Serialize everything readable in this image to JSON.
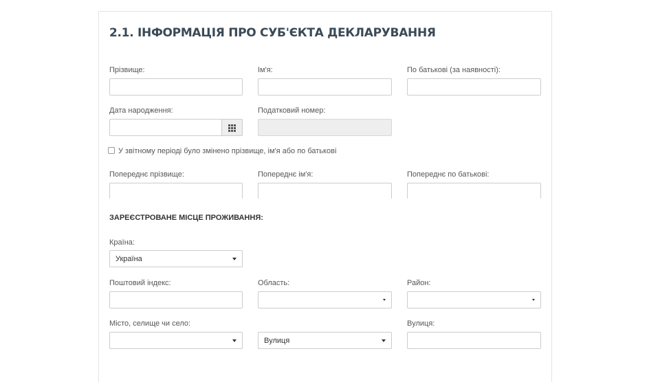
{
  "section_title": "2.1. ІНФОРМАЦІЯ ПРО СУБ'ЄКТА ДЕКЛАРУВАННЯ",
  "fields": {
    "surname_label": "Прізвище:",
    "name_label": "Ім'я:",
    "patronymic_label": "По батькові (за наявності):",
    "birth_date_label": "Дата народження:",
    "tax_number_label": "Податковий номер:",
    "name_changed_label": "У звітному періоді було змінено прізвище, ім'я або по батькові",
    "prev_surname_label": "Попереднє прізвище:",
    "prev_name_label": "Попереднє ім'я:",
    "prev_patronymic_label": "Попереднє по батькові:"
  },
  "residence": {
    "heading": "ЗАРЕЄСТРОВАНЕ МІСЦЕ ПРОЖИВАННЯ:",
    "country_label": "Країна:",
    "country_value": "Україна",
    "postal_label": "Поштовий індекс:",
    "region_label": "Область:",
    "district_label": "Район:",
    "city_label": "Місто, селище чи село:",
    "street_type_value": "Вулиця",
    "street_label": "Вулиця:"
  },
  "icons": {
    "calendar": "calendar-grid-icon",
    "dropdown": "caret-down-icon"
  },
  "colors": {
    "title": "#3a4a57",
    "border": "#cccccc",
    "disabled_bg": "#eeeeee"
  }
}
